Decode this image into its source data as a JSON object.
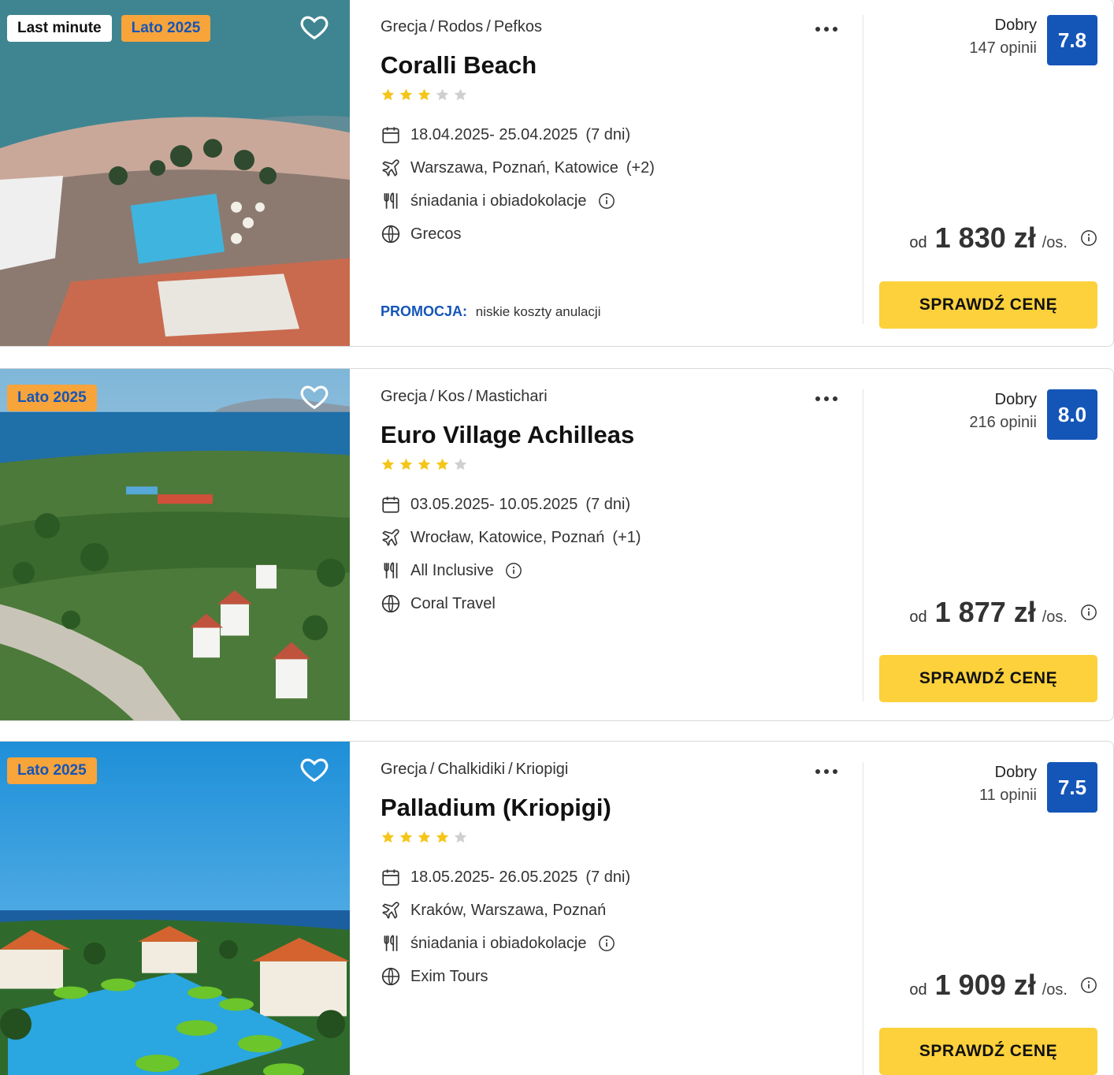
{
  "offers": [
    {
      "badges": [
        "Last minute",
        "Lato 2025"
      ],
      "breadcrumb": [
        "Grecja",
        "Rodos",
        "Pefkos"
      ],
      "name": "Coralli Beach",
      "stars": 3,
      "dates": "18.04.2025- 25.04.2025",
      "duration": "(7 dni)",
      "departures": "Warszawa, Poznań, Katowice",
      "departures_extra": "(+2)",
      "board": "śniadania i obiadokolacje",
      "operator": "Grecos",
      "promo_label": "PROMOCJA:",
      "promo_text": "niskie koszty anulacji",
      "rating_word": "Dobry",
      "rating_count": "147 opinii",
      "score": "7.8",
      "price_prefix": "od",
      "price": "1 830 zł",
      "price_unit": "/os.",
      "cta": "SPRAWDŹ CENĘ"
    },
    {
      "badges": [
        "Lato 2025"
      ],
      "breadcrumb": [
        "Grecja",
        "Kos",
        "Mastichari"
      ],
      "name": "Euro Village Achilleas",
      "stars": 4,
      "dates": "03.05.2025- 10.05.2025",
      "duration": "(7 dni)",
      "departures": "Wrocław, Katowice, Poznań",
      "departures_extra": "(+1)",
      "board": "All Inclusive",
      "operator": "Coral Travel",
      "rating_word": "Dobry",
      "rating_count": "216 opinii",
      "score": "8.0",
      "price_prefix": "od",
      "price": "1 877 zł",
      "price_unit": "/os.",
      "cta": "SPRAWDŹ CENĘ"
    },
    {
      "badges": [
        "Lato 2025"
      ],
      "breadcrumb": [
        "Grecja",
        "Chalkidiki",
        "Kriopigi"
      ],
      "name": "Palladium (Kriopigi)",
      "stars": 4,
      "dates": "18.05.2025- 26.05.2025",
      "duration": "(7 dni)",
      "departures": "Kraków, Warszawa, Poznań",
      "board": "śniadania i obiadokolacje",
      "operator": "Exim Tours",
      "rating_word": "Dobry",
      "rating_count": "11 opinii",
      "score": "7.5",
      "price_prefix": "od",
      "price": "1 909 zł",
      "price_unit": "/os.",
      "cta": "SPRAWDŹ CENĘ"
    }
  ],
  "colors": {
    "brand_blue": "#1455b8",
    "cta_yellow": "#fcd13b",
    "badge_orange": "#f7a43b",
    "star_gold": "#f5c518",
    "star_grey": "#cfcfcf"
  },
  "icons": [
    "heart-icon",
    "calendar-icon",
    "plane-icon",
    "cutlery-icon",
    "globe-icon",
    "info-icon",
    "more-dots-icon",
    "star-icon"
  ]
}
